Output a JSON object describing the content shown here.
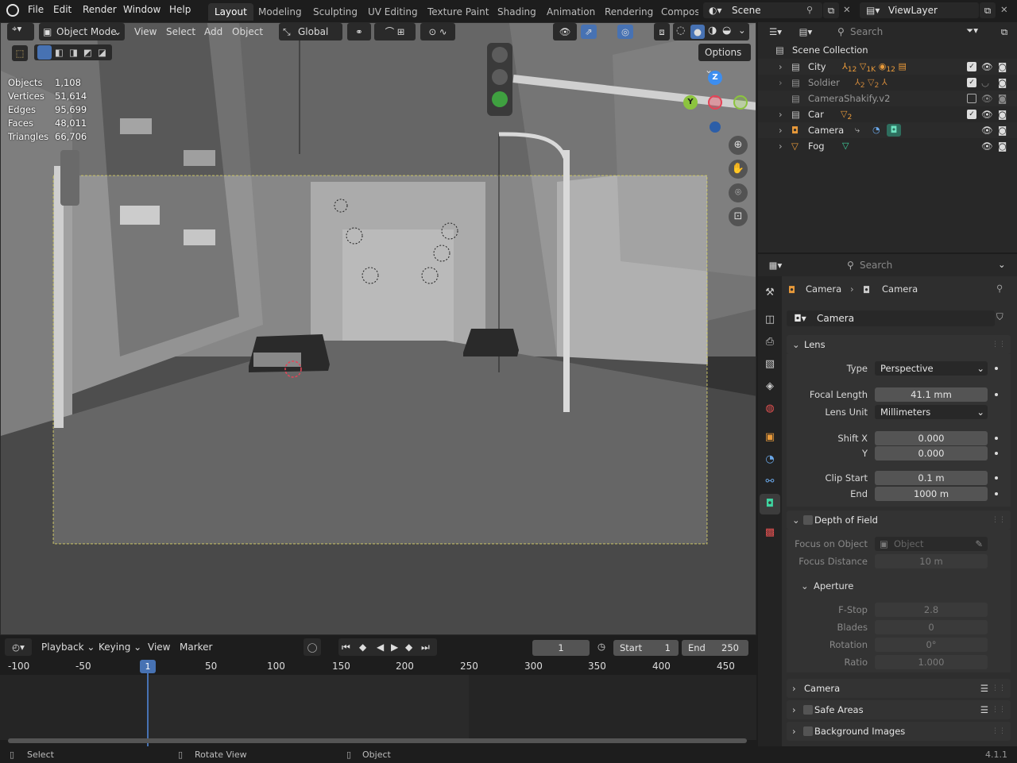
{
  "topbar": {
    "menus": [
      "File",
      "Edit",
      "Render",
      "Window",
      "Help"
    ],
    "workspaces": [
      "Layout",
      "Modeling",
      "Sculpting",
      "UV Editing",
      "Texture Paint",
      "Shading",
      "Animation",
      "Rendering",
      "Compos"
    ],
    "active_workspace": "Layout",
    "scene": "Scene",
    "view_layer": "ViewLayer"
  },
  "viewport": {
    "mode": "Object Mode",
    "menus": [
      "View",
      "Select",
      "Add",
      "Object"
    ],
    "orientation": "Global",
    "options_label": "Options",
    "stats": [
      {
        "label": "Objects",
        "value": "1,108"
      },
      {
        "label": "Vertices",
        "value": "51,614"
      },
      {
        "label": "Edges",
        "value": "95,699"
      },
      {
        "label": "Faces",
        "value": "48,011"
      },
      {
        "label": "Triangles",
        "value": "66,706"
      }
    ],
    "gizmo": {
      "z": "Z",
      "y": "Y"
    }
  },
  "outliner": {
    "search_placeholder": "Search",
    "root": "Scene Collection",
    "items": [
      {
        "name": "City",
        "badges": [
          "12",
          "1K",
          "12"
        ]
      },
      {
        "name": "Soldier",
        "badges": [
          "2",
          "2"
        ]
      },
      {
        "name": "CameraShakify.v2",
        "badges": []
      },
      {
        "name": "Car",
        "badges": [
          "2"
        ]
      },
      {
        "name": "Camera",
        "badges": []
      },
      {
        "name": "Fog",
        "badges": []
      }
    ]
  },
  "properties": {
    "search_placeholder": "Search",
    "breadcrumb": [
      "Camera",
      "Camera"
    ],
    "datablock": "Camera",
    "lens": {
      "title": "Lens",
      "type_label": "Type",
      "type_value": "Perspective",
      "focal_label": "Focal Length",
      "focal_value": "41.1 mm",
      "unit_label": "Lens Unit",
      "unit_value": "Millimeters",
      "shiftx_label": "Shift X",
      "shiftx_value": "0.000",
      "shifty_label": "Y",
      "shifty_value": "0.000",
      "clipstart_label": "Clip Start",
      "clipstart_value": "0.1 m",
      "clipend_label": "End",
      "clipend_value": "1000 m"
    },
    "dof": {
      "title": "Depth of Field",
      "focus_obj_label": "Focus on Object",
      "focus_obj_placeholder": "Object",
      "focus_dist_label": "Focus Distance",
      "focus_dist_value": "10 m",
      "aperture_title": "Aperture",
      "fstop_label": "F-Stop",
      "fstop_value": "2.8",
      "blades_label": "Blades",
      "blades_value": "0",
      "rotation_label": "Rotation",
      "rotation_value": "0°",
      "ratio_label": "Ratio",
      "ratio_value": "1.000"
    },
    "panels": [
      "Camera",
      "Safe Areas",
      "Background Images"
    ]
  },
  "timeline": {
    "menus": [
      "Playback",
      "Keying",
      "View",
      "Marker"
    ],
    "current_frame": "1",
    "start_label": "Start",
    "start_value": "1",
    "end_label": "End",
    "end_value": "250",
    "ruler": [
      "-100",
      "-50",
      "1",
      "50",
      "100",
      "150",
      "200",
      "250",
      "300",
      "350",
      "400",
      "450"
    ]
  },
  "statusbar": {
    "items": [
      "Select",
      "Rotate View",
      "Object"
    ],
    "version": "4.1.1"
  },
  "colors": {
    "accent_blue": "#4772b3",
    "active_tab": "#303030",
    "gizmo_x": "#e54457",
    "gizmo_y": "#8cc43f",
    "gizmo_z": "#3d8ef0",
    "camera_frame": "#d9d36b"
  }
}
